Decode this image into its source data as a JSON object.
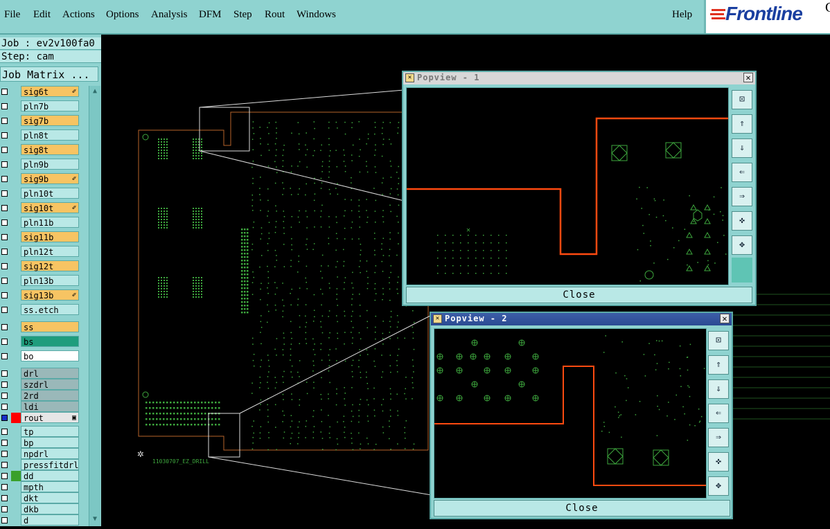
{
  "menu": {
    "items": [
      "File",
      "Edit",
      "Actions",
      "Options",
      "Analysis",
      "DFM",
      "Step",
      "Rout",
      "Windows"
    ],
    "help": "Help"
  },
  "logo": {
    "text": "Frontline",
    "extra": "G"
  },
  "job": {
    "job_line": "Job : ev2v100fa0",
    "step_line": "Step: cam",
    "matrix_button": "Job Matrix ..."
  },
  "layers": [
    {
      "name": "sig6t",
      "type": "sig",
      "mark": true
    },
    {
      "name": "pln7b",
      "type": "pln"
    },
    {
      "name": "sig7b",
      "type": "sig"
    },
    {
      "name": "pln8t",
      "type": "pln"
    },
    {
      "name": "sig8t",
      "type": "sig"
    },
    {
      "name": "pln9b",
      "type": "pln"
    },
    {
      "name": "sig9b",
      "type": "sig",
      "mark": true
    },
    {
      "name": "pln10t",
      "type": "pln"
    },
    {
      "name": "sig10t",
      "type": "sig",
      "mark": true
    },
    {
      "name": "pln11b",
      "type": "pln"
    },
    {
      "name": "sig11b",
      "type": "sig"
    },
    {
      "name": "pln12t",
      "type": "pln"
    },
    {
      "name": "sig12t",
      "type": "sig"
    },
    {
      "name": "pln13b",
      "type": "pln"
    },
    {
      "name": "sig13b",
      "type": "sig",
      "mark": true
    },
    {
      "name": "ss.etch",
      "type": "pln"
    },
    {
      "name": "ss",
      "type": "sig"
    },
    {
      "name": "bs",
      "type": "bs"
    },
    {
      "name": "bo",
      "type": "bo"
    },
    {
      "name": "drl",
      "type": "drl"
    },
    {
      "name": "szdrl",
      "type": "drl"
    },
    {
      "name": "2rd",
      "type": "drl"
    },
    {
      "name": "ldi",
      "type": "drl"
    },
    {
      "name": "rout",
      "type": "rout",
      "swatch": "#ff0000",
      "mark2": true
    },
    {
      "name": "tp",
      "type": "pln"
    },
    {
      "name": "bp",
      "type": "pln"
    },
    {
      "name": "npdrl",
      "type": "pln"
    },
    {
      "name": "pressfitdrl",
      "type": "pln"
    },
    {
      "name": "dd",
      "type": "pln",
      "swatch": "#3aa02b"
    },
    {
      "name": "mpth",
      "type": "pln"
    },
    {
      "name": "dkt",
      "type": "pln"
    },
    {
      "name": "dkb",
      "type": "pln"
    },
    {
      "name": "d",
      "type": "pln"
    }
  ],
  "board": {
    "caption": "11030707_EZ_DRILL"
  },
  "popview1": {
    "title": "Popview - 1",
    "close": "Close"
  },
  "popview2": {
    "title": "Popview - 2",
    "close": "Close"
  },
  "colors": {
    "ui_teal": "#8fd3d0",
    "trace_orange": "#ff4a10",
    "feature_green": "#3ea83e"
  },
  "tool_icons": [
    "zoom-fit-icon",
    "pan-up-icon",
    "pan-down-icon",
    "pan-left-icon",
    "pan-right-icon",
    "zoom-in-icon",
    "zoom-out-icon"
  ]
}
